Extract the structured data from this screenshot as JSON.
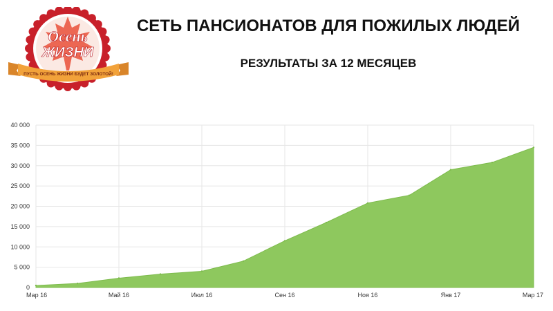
{
  "header": {
    "title": "СЕТЬ ПАНСИОНАТОВ ДЛЯ ПОЖИЛЫХ ЛЮДЕЙ",
    "subtitle": "РЕЗУЛЬТАТЫ ЗА 12 МЕСЯЦЕВ"
  },
  "logo": {
    "line1": "Осень",
    "line2": "ЖИЗНИ",
    "ribbon": "ПУСТЬ ОСЕНЬ ЖИЗНИ БУДЕТ ЗОЛОТОЙ!",
    "colors": {
      "seal": "#c8202a",
      "ribbon": "#f2a23a",
      "leaf": "#e9503a"
    }
  },
  "chart_data": {
    "type": "area",
    "title": "",
    "xlabel": "",
    "ylabel": "",
    "x": [
      "Мар 16",
      "Апр 16",
      "Май 16",
      "Июн 16",
      "Июл 16",
      "Авг 16",
      "Сен 16",
      "Окт 16",
      "Ноя 16",
      "Дек 16",
      "Янв 17",
      "Фев 17",
      "Мар 17"
    ],
    "x_tick_labels": [
      "Мар 16",
      "Май 16",
      "Июл 16",
      "Сен 16",
      "Ноя 16",
      "Янв 17",
      "Мар 17"
    ],
    "series": [
      {
        "name": "",
        "values": [
          500,
          1000,
          2300,
          3300,
          4000,
          6500,
          11500,
          16000,
          20800,
          22700,
          29000,
          30800,
          34500
        ]
      }
    ],
    "ylim": [
      0,
      40000
    ],
    "y_ticks": [
      0,
      5000,
      10000,
      15000,
      20000,
      25000,
      30000,
      35000,
      40000
    ],
    "y_tick_labels": [
      "0",
      "5 000",
      "10 000",
      "15 000",
      "20 000",
      "25 000",
      "30 000",
      "35 000",
      "40 000"
    ],
    "grid": true,
    "colors": {
      "fill": "#8ec85e",
      "stroke": "#7dbb4c",
      "grid": "#e6e6e6"
    }
  }
}
